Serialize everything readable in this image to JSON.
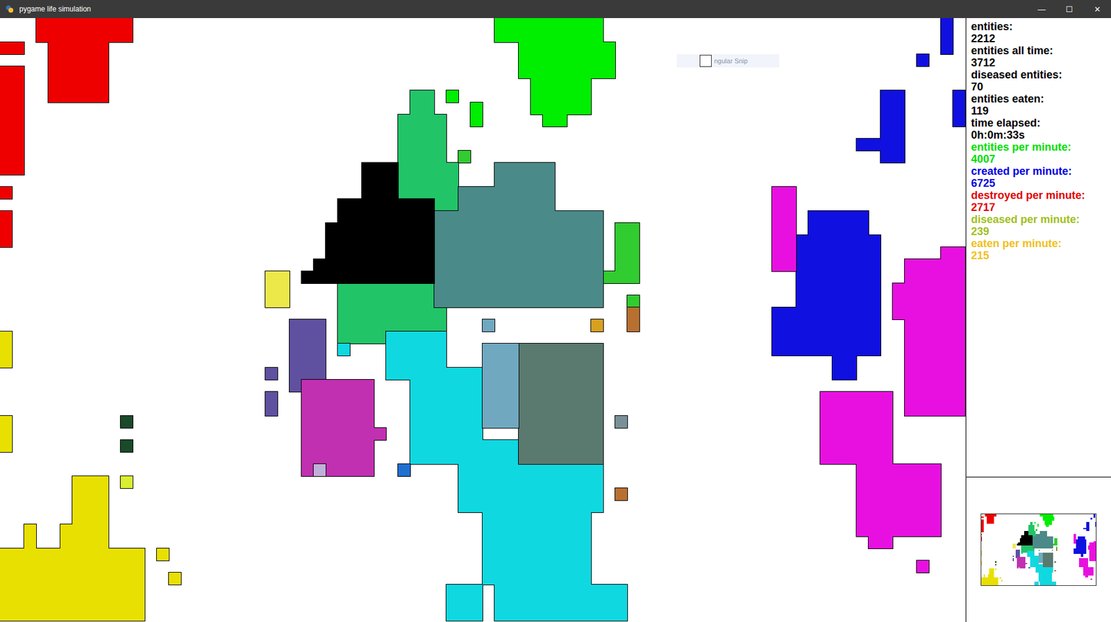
{
  "window": {
    "title": "pygame life simulation",
    "controls": [
      "—",
      "☐",
      "✕"
    ]
  },
  "snip_overlay": {
    "label": "ngular Snip"
  },
  "world": {
    "colonies": [
      {
        "name": "red",
        "color": "#ee0000",
        "cells": [
          [
            3,
            0,
            8,
            2
          ],
          [
            4,
            2,
            5,
            5
          ],
          [
            0,
            2,
            2,
            1
          ],
          [
            0,
            4,
            2,
            9
          ],
          [
            0,
            14,
            1,
            1
          ],
          [
            0,
            16,
            1,
            3
          ]
        ]
      },
      {
        "name": "green",
        "color": "#00ee00",
        "cells": [
          [
            41,
            0,
            9,
            2
          ],
          [
            43,
            2,
            8,
            3
          ],
          [
            44,
            5,
            5,
            3
          ],
          [
            45,
            8,
            2,
            1
          ],
          [
            37,
            6,
            1,
            1
          ],
          [
            39,
            7,
            1,
            2
          ]
        ]
      },
      {
        "name": "light-green",
        "color": "#30cc30",
        "cells": [
          [
            51,
            17,
            2,
            5
          ],
          [
            50,
            21,
            1,
            1
          ],
          [
            52,
            23,
            1,
            1
          ],
          [
            38,
            11,
            1,
            1
          ]
        ]
      },
      {
        "name": "sea-green",
        "color": "#22c468",
        "cells": [
          [
            33,
            8,
            4,
            4
          ],
          [
            34,
            6,
            2,
            2
          ],
          [
            32,
            12,
            6,
            5
          ],
          [
            28,
            22,
            9,
            5
          ],
          [
            31,
            26,
            1,
            1
          ]
        ]
      },
      {
        "name": "teal-gray",
        "color": "#4a8a88",
        "cells": [
          [
            38,
            14,
            8,
            6
          ],
          [
            36,
            16,
            14,
            8
          ],
          [
            41,
            12,
            3,
            2
          ],
          [
            44,
            12,
            2,
            3
          ]
        ]
      },
      {
        "name": "black",
        "color": "#000000",
        "cells": [
          [
            30,
            12,
            3,
            3
          ],
          [
            28,
            15,
            8,
            7
          ],
          [
            25,
            21,
            5,
            1
          ],
          [
            27,
            17,
            2,
            3
          ],
          [
            26,
            20,
            2,
            1
          ]
        ]
      },
      {
        "name": "cyan",
        "color": "#10d8e0",
        "cells": [
          [
            32,
            26,
            5,
            4
          ],
          [
            34,
            29,
            6,
            8
          ],
          [
            38,
            35,
            12,
            6
          ],
          [
            40,
            41,
            9,
            6
          ],
          [
            41,
            47,
            11,
            3
          ],
          [
            37,
            47,
            3,
            3
          ],
          [
            28,
            27,
            1,
            1
          ]
        ]
      },
      {
        "name": "slate-green",
        "color": "#5a7a70",
        "cells": [
          [
            43,
            27,
            7,
            10
          ]
        ]
      },
      {
        "name": "steel-blue",
        "color": "#70a8c0",
        "cells": [
          [
            40,
            27,
            3,
            7
          ],
          [
            40,
            25,
            1,
            1
          ]
        ]
      },
      {
        "name": "slate-purple",
        "color": "#6050a0",
        "cells": [
          [
            24,
            25,
            3,
            6
          ],
          [
            22,
            29,
            1,
            1
          ],
          [
            22,
            31,
            1,
            2
          ]
        ]
      },
      {
        "name": "purple-magenta",
        "color": "#c030b0",
        "cells": [
          [
            25,
            30,
            6,
            8
          ],
          [
            31,
            34,
            1,
            1
          ],
          [
            25,
            36,
            1,
            1
          ]
        ]
      },
      {
        "name": "pale-yellow",
        "color": "#ece84a",
        "cells": [
          [
            22,
            21,
            2,
            3
          ]
        ]
      },
      {
        "name": "blue",
        "color": "#1010e0",
        "cells": [
          [
            67,
            16,
            5,
            2
          ],
          [
            66,
            18,
            7,
            6
          ],
          [
            64,
            24,
            9,
            4
          ],
          [
            69,
            28,
            2,
            2
          ],
          [
            78,
            0,
            1,
            3
          ],
          [
            73,
            6,
            2,
            6
          ],
          [
            71,
            10,
            4,
            1
          ],
          [
            76,
            3,
            1,
            1
          ],
          [
            79,
            6,
            1,
            3
          ]
        ]
      },
      {
        "name": "magenta",
        "color": "#e810e0",
        "cells": [
          [
            64,
            14,
            2,
            7
          ],
          [
            74,
            22,
            6,
            3
          ],
          [
            75,
            20,
            5,
            2
          ],
          [
            78,
            19,
            2,
            2
          ],
          [
            75,
            25,
            5,
            8
          ],
          [
            68,
            31,
            6,
            6
          ],
          [
            71,
            37,
            7,
            6
          ],
          [
            72,
            43,
            2,
            1
          ],
          [
            64,
            14,
            1,
            1
          ],
          [
            76,
            45,
            1,
            1
          ]
        ]
      },
      {
        "name": "yellow",
        "color": "#e8e000",
        "cells": [
          [
            0,
            44,
            12,
            6
          ],
          [
            5,
            42,
            4,
            2
          ],
          [
            6,
            38,
            3,
            4
          ],
          [
            2,
            42,
            1,
            2
          ],
          [
            0,
            26,
            1,
            3
          ],
          [
            0,
            33,
            1,
            3
          ],
          [
            13,
            44,
            1,
            1
          ],
          [
            14,
            46,
            1,
            1
          ]
        ]
      },
      {
        "name": "dark-green",
        "color": "#1a4a2a",
        "cells": [
          [
            10,
            33,
            1,
            1
          ],
          [
            10,
            35,
            1,
            1
          ]
        ]
      },
      {
        "name": "yellow-green",
        "color": "#d8ee30",
        "cells": [
          [
            10,
            38,
            1,
            1
          ]
        ]
      },
      {
        "name": "brown",
        "color": "#b87030",
        "cells": [
          [
            52,
            24,
            1,
            2
          ],
          [
            51,
            39,
            1,
            1
          ]
        ]
      },
      {
        "name": "orange",
        "color": "#d8a020",
        "cells": [
          [
            49,
            25,
            1,
            1
          ]
        ]
      },
      {
        "name": "gray-blue",
        "color": "#7a9098",
        "cells": [
          [
            51,
            33,
            1,
            1
          ]
        ]
      },
      {
        "name": "lavender",
        "color": "#c0b0d8",
        "cells": [
          [
            26,
            37,
            1,
            1
          ]
        ]
      },
      {
        "name": "azure",
        "color": "#2070d0",
        "cells": [
          [
            33,
            37,
            1,
            1
          ]
        ]
      }
    ]
  },
  "stats": [
    {
      "label": "entities:",
      "value": "2212",
      "color": "#000000"
    },
    {
      "label": "entities all time:",
      "value": "3712",
      "color": "#000000"
    },
    {
      "label": "diseased entities:",
      "value": "70",
      "color": "#000000"
    },
    {
      "label": "entities eaten:",
      "value": "119",
      "color": "#000000"
    },
    {
      "label": "time elapsed:",
      "value": "0h:0m:33s",
      "color": "#000000"
    },
    {
      "label": "entities per minute:",
      "value": "4007",
      "color": "#00e000"
    },
    {
      "label": "created per minute:",
      "value": "6725",
      "color": "#0000e0"
    },
    {
      "label": "destroyed per minute:",
      "value": "2717",
      "color": "#e00000"
    },
    {
      "label": "diseased per minute:",
      "value": "239",
      "color": "#a0c020"
    },
    {
      "label": "eaten per minute:",
      "value": "215",
      "color": "#f0c020"
    }
  ]
}
